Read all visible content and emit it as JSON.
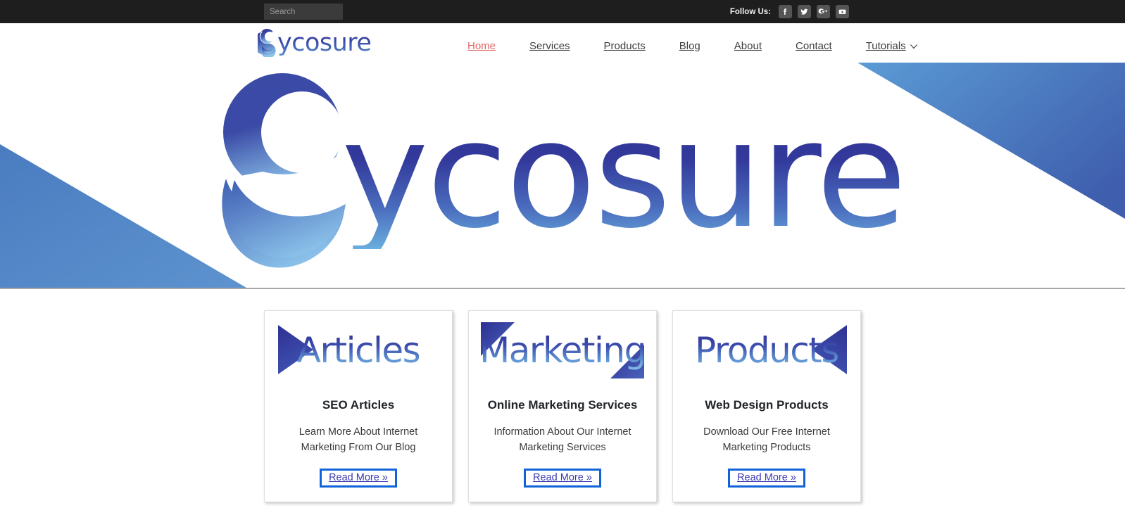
{
  "topbar": {
    "search": {
      "placeholder": "Search",
      "value": ""
    },
    "follow_label": "Follow Us:",
    "social": [
      {
        "name": "facebook-icon",
        "label": "f"
      },
      {
        "name": "twitter-icon",
        "label": "t"
      },
      {
        "name": "google-plus-icon",
        "label": "g+"
      },
      {
        "name": "youtube-icon",
        "label": "yt"
      }
    ]
  },
  "header": {
    "logo_text": "ycosure",
    "logo_full": "Sycosure",
    "nav": [
      {
        "label": "Home",
        "active": true,
        "caret": false
      },
      {
        "label": "Services",
        "active": false,
        "caret": false
      },
      {
        "label": "Products",
        "active": false,
        "caret": false
      },
      {
        "label": "Blog",
        "active": false,
        "caret": false
      },
      {
        "label": "About",
        "active": false,
        "caret": false
      },
      {
        "label": "Contact",
        "active": false,
        "caret": false
      },
      {
        "label": "Tutorials",
        "active": false,
        "caret": true
      }
    ]
  },
  "hero": {
    "text": "ycosure",
    "full_text": "Sycosure",
    "accent_color": "#4a7cc0",
    "text_gradient_top": "#2e3192",
    "text_gradient_bottom": "#6aaede"
  },
  "cards": [
    {
      "image_word": "Articles",
      "title": "SEO Articles",
      "desc": "Learn More About Internet Marketing From Our Blog",
      "cta": "Read More",
      "cta_chevron": "»",
      "arrow": "right"
    },
    {
      "image_word": "Marketing",
      "title": "Online Marketing Services",
      "desc": "Information About Our Internet Marketing Services",
      "cta": "Read More",
      "cta_chevron": "»",
      "arrow": "corner"
    },
    {
      "image_word": "Products",
      "title": "Web Design Products",
      "desc": "Download Our Free Internet Marketing Products",
      "cta": "Read More",
      "cta_chevron": "»",
      "arrow": "left"
    }
  ]
}
